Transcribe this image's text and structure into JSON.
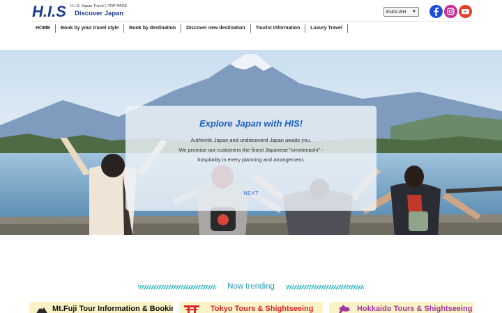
{
  "header": {
    "logo_text": "H.I.S",
    "site_subtitle": "H.I.S. Japan Travel | TOP PAGE",
    "site_title": "Discover Japan",
    "language": {
      "selected": "ENGLISH"
    },
    "social": [
      "facebook-icon",
      "instagram-icon",
      "youtube-icon"
    ]
  },
  "nav": {
    "items": [
      {
        "label": "HOME"
      },
      {
        "label": "Book by your travel style"
      },
      {
        "label": "Book by destination"
      },
      {
        "label": "Discover new destination"
      },
      {
        "label": "Tourist Information"
      },
      {
        "label": "Luxury Travel"
      }
    ]
  },
  "hero": {
    "title": "Explore Japan with HIS!",
    "lines": [
      "Authentic Japan and undiscoverd Japan awaits you.",
      "We promise our customers the finest Japanese \"omotenashi\" -",
      "hospitality in every planning and arrangement."
    ],
    "next_label": "NEXT"
  },
  "trending": {
    "title": "Now trending",
    "cards": [
      {
        "label": "Mt.Fuji Tour Information & Booking"
      },
      {
        "label": "Tokyo Tours & Shightseeing"
      },
      {
        "label": "Hokkaido Tours & Shightseeing"
      }
    ]
  },
  "colors": {
    "brand_blue": "#1a3c8c",
    "link_blue": "#2a6ad4",
    "trend_teal": "#2b9bb4",
    "card_bg": "#fbf3c5",
    "tokyo_red": "#d9262c",
    "hokkaido_purple": "#a236a0"
  }
}
